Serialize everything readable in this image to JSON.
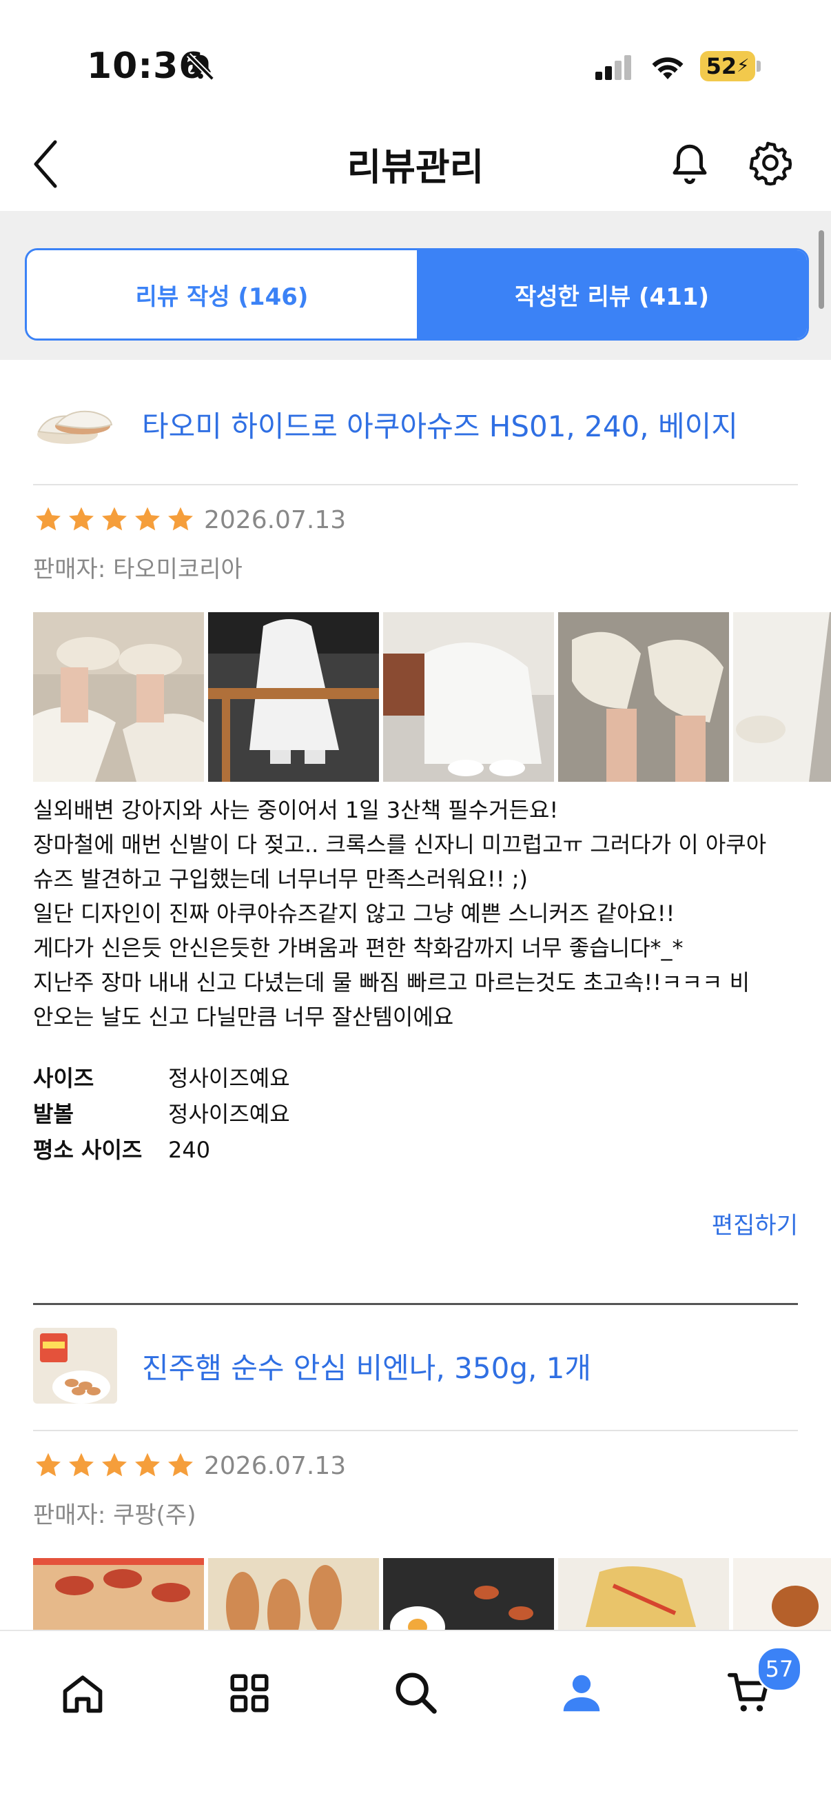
{
  "status_bar": {
    "time": "10:36",
    "battery": "52",
    "icons": [
      "bell-slash-icon",
      "signal-icon",
      "wifi-icon",
      "battery-charging-icon"
    ]
  },
  "header": {
    "title": "리뷰관리",
    "icons": [
      "back-chevron-icon",
      "bell-icon",
      "gear-icon"
    ]
  },
  "tabs": [
    {
      "label": "리뷰 작성 (146)",
      "active": false
    },
    {
      "label": "작성한 리뷰 (411)",
      "active": true
    }
  ],
  "reviews": [
    {
      "product": "타오미 하이드로 아쿠아슈즈 HS01, 240, 베이지",
      "rating": 5,
      "date": "2026.07.13",
      "seller": "판매자: 타오미코리아",
      "photos": 5,
      "text_lines": [
        "실외배변 강아지와 사는 중이어서 1일 3산책 필수거든요!",
        "장마철에 매번 신발이 다 젖고.. 크록스를 신자니 미끄럽고ㅠ 그러다가 이 아쿠아",
        "슈즈 발견하고 구입했는데 너무너무 만족스러워요!! ;)",
        "일단 디자인이 진짜 아쿠아슈즈같지 않고 그냥 예쁜 스니커즈 같아요!!",
        "게다가 신은듯 안신은듯한 가벼움과 편한 착화감까지 너무 좋습니다*_*",
        "지난주 장마 내내 신고 다녔는데 물 빠짐 빠르고 마르는것도 초고속!!ㅋㅋㅋ 비",
        "안오는 날도 신고 다닐만큼 너무 잘산템이에요"
      ],
      "attributes": [
        {
          "key": "사이즈",
          "value": "정사이즈예요"
        },
        {
          "key": "발볼",
          "value": "정사이즈예요"
        },
        {
          "key": "평소 사이즈",
          "value": "240"
        }
      ],
      "edit_label": "편집하기"
    },
    {
      "product": "진주햄 순수 안심 비엔나, 350g, 1개",
      "rating": 5,
      "date": "2026.07.13",
      "seller": "판매자: 쿠팡(주)",
      "photos": 5
    }
  ],
  "bottom_nav": {
    "items": [
      "home-icon",
      "grid-icon",
      "search-icon",
      "user-icon",
      "cart-icon"
    ],
    "active": "user-icon",
    "cart_count": "57"
  },
  "colors": {
    "accent": "#3B82F6",
    "link": "#2F6FE3",
    "star": "#F59E3B"
  }
}
